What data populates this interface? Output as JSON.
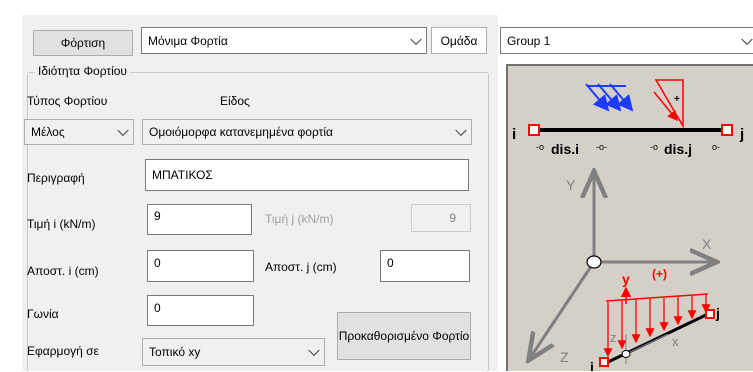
{
  "header": {
    "load_button_label": "Φόρτιση",
    "load_case_value": "Μόνιμα Φορτία",
    "group_label": "Ομάδα",
    "group_value": "Group 1"
  },
  "properties": {
    "group_title": "Ιδιότητα Φορτίου",
    "load_type_label": "Τύπος Φορτίου",
    "kind_label": "Είδος",
    "load_type_value": "Μέλος",
    "kind_value": "Ομοιόμορφα κατανεμημένα φορτία",
    "description_label": "Περιγραφή",
    "description_value": "ΜΠΑΤΙΚΟΣ",
    "value_i_label": "Τιμή i (kN/m)",
    "value_i": "9",
    "value_j_label": "Τιμή j (kN/m)",
    "value_j": "9",
    "dist_i_label": "Αποστ. i (cm)",
    "dist_i": "0",
    "dist_j_label": "Αποστ. j (cm)",
    "dist_j": "0",
    "angle_label": "Γωνία",
    "angle_value": "0",
    "apply_label": "Εφαρμογή σε",
    "apply_value": "Τοπικό xy",
    "preset_button_label": "Προκαθορισμένο Φορτίο"
  },
  "diagram": {
    "node_i": "i",
    "node_j": "j",
    "dis_i": "dis.i",
    "dis_j": "dis.j",
    "axis_y": "Y",
    "axis_x": "X",
    "axis_z": "Z",
    "local_y": "y",
    "local_x": "x",
    "local_z": "z",
    "plus_label": "(+)",
    "plus_sign": "+",
    "small_i": "i",
    "small_j": "j",
    "colors": {
      "background": "#d4d0c8",
      "load": "#ff0000",
      "arrow_blue": "#1e3cff",
      "axis": "#808080"
    }
  }
}
